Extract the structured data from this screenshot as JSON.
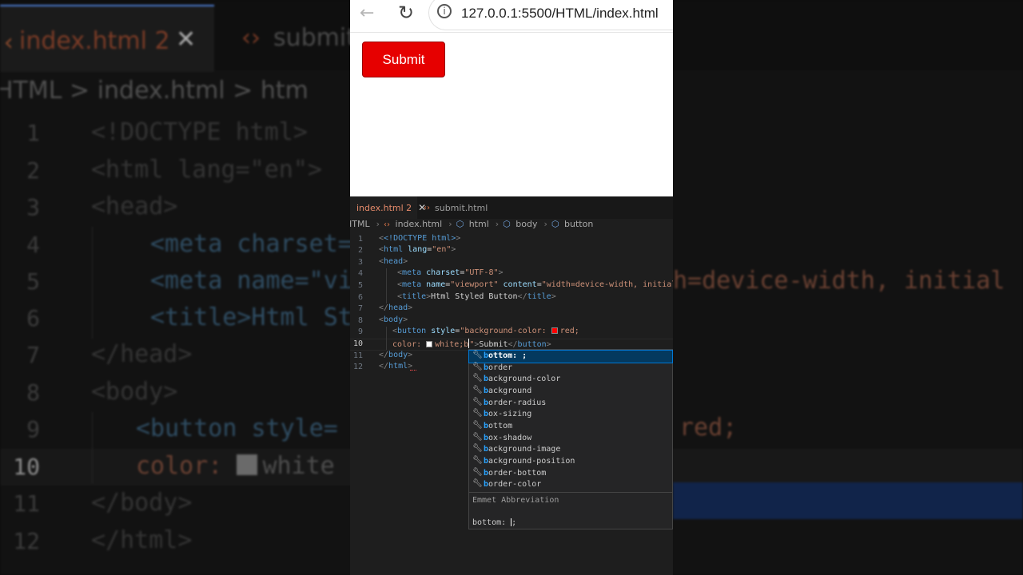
{
  "browser": {
    "url": "127.0.0.1:5500/HTML/index.html",
    "preview_button_label": "Submit"
  },
  "editor": {
    "tabs": [
      {
        "label": "index.html",
        "badge": "2",
        "active": true
      },
      {
        "label": "submit.html",
        "active": false
      }
    ],
    "breadcrumb": [
      "HTML",
      "index.html",
      "html",
      "body",
      "button"
    ],
    "code": {
      "line_numbers": [
        "1",
        "2",
        "3",
        "4",
        "5",
        "6",
        "7",
        "8",
        "9",
        "10",
        "11",
        "12"
      ],
      "doctype": "<!DOCTYPE html>",
      "html_open_tag": "html",
      "lang_attr": "lang",
      "lang_val": "\"en\"",
      "head_tag": "head",
      "meta_tag": "meta",
      "charset_attr": "charset",
      "charset_val": "\"UTF-8\"",
      "name_attr": "name",
      "name_val": "\"viewport\"",
      "content_attr": "content",
      "content_val": "\"width=device-width, initial",
      "title_tag": "title",
      "title_text": "Html Styled Button",
      "body_tag": "body",
      "button_tag": "button",
      "style_attr": "style",
      "style_val_start": "\"background-color: ",
      "style_val_red": "red;",
      "color_prop": "color: ",
      "color_val": "white;b",
      "quote_close": "\"",
      "button_text": "Submit",
      "html_close_tag": "html"
    }
  },
  "suggest": {
    "items": [
      {
        "bold": "b",
        "rest": "ottom: ;",
        "selected": true
      },
      {
        "bold": "b",
        "rest": "order"
      },
      {
        "bold": "b",
        "rest": "ackground-color"
      },
      {
        "bold": "b",
        "rest": "ackground"
      },
      {
        "bold": "b",
        "rest": "order-radius"
      },
      {
        "bold": "b",
        "rest": "ox-sizing"
      },
      {
        "bold": "b",
        "rest": "ottom"
      },
      {
        "bold": "b",
        "rest": "ox-shadow"
      },
      {
        "bold": "b",
        "rest": "ackground-image"
      },
      {
        "bold": "b",
        "rest": "ackground-position"
      },
      {
        "bold": "b",
        "rest": "order-bottom"
      },
      {
        "bold": "b",
        "rest": "order-color"
      }
    ],
    "detail_title": "Emmet Abbreviation",
    "detail_text": "bottom: ",
    "detail_text_end": ";"
  },
  "background_zoom": {
    "tab_label": "index.html 2",
    "tab2_label": "submit",
    "breadcrumb": "HTML  >   index.html  >   htm",
    "lines": {
      "l1": "<!DOCTYPE html>",
      "l2": "<html lang=\"en\">",
      "l3": "<head>",
      "l4": "<meta charset=",
      "l5": "<meta name=\"vi",
      "l6": "<title>Html St",
      "l7": "</head>",
      "l8": "<body>",
      "l9": "<button style=",
      "l10a": "color: ",
      "l10b": "white",
      "l11": "</body>",
      "l12": "</html>",
      "right_frag": "h=device-width, initial",
      "right_red": "red;"
    }
  },
  "colors": {
    "preview_button_bg": "#e60000",
    "swatch_red": "#ff0000",
    "swatch_white": "#ffffff",
    "suggest_selected": "#04395e"
  }
}
